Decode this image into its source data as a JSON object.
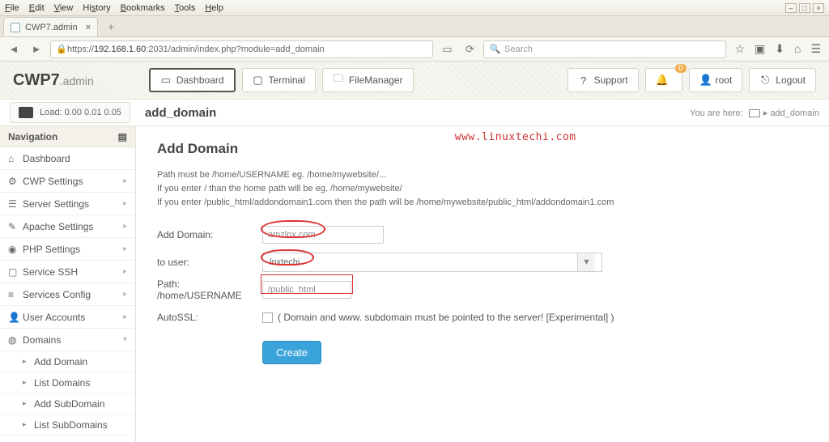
{
  "os_menubar": {
    "items": [
      "File",
      "Edit",
      "View",
      "History",
      "Bookmarks",
      "Tools",
      "Help"
    ]
  },
  "browser": {
    "tab_title": "CWP7.admin",
    "url_prefix": "https://",
    "url_host": "192.168.1.60",
    "url_rest": ":2031/admin/index.php?module=add_domain",
    "search_placeholder": "Search"
  },
  "brand": {
    "main": "CWP7",
    "suffix": ".admin"
  },
  "header_buttons": {
    "dashboard": "Dashboard",
    "terminal": "Terminal",
    "filemanager": "FileManager",
    "support": "Support",
    "user": "root",
    "logout": "Logout",
    "notif_count": "0"
  },
  "crumb": {
    "load_label": "Load: 0.00  0.01  0.05",
    "page_title": "add_domain",
    "here": "You are here:",
    "link": "add_domain"
  },
  "nav": {
    "header": "Navigation",
    "items": [
      "Dashboard",
      "CWP Settings",
      "Server Settings",
      "Apache Settings",
      "PHP Settings",
      "Service SSH",
      "Services Config",
      "User Accounts",
      "Domains"
    ],
    "sub": [
      "Add Domain",
      "List Domains",
      "Add SubDomain",
      "List SubDomains"
    ]
  },
  "content": {
    "title": "Add Domain",
    "help1": "Path must be /home/USERNAME eg. /home/mywebsite/...",
    "help2": "If you enter / than the home path will be eg. /home/mywebsite/",
    "help3": "If you enter /public_html/addondomain1.com then the path will be /home/mywebsite/public_html/addondomain1.com",
    "labels": {
      "add_domain": "Add Domain:",
      "to_user": "to user:",
      "path": "Path: /home/USERNAME",
      "autossl": "AutoSSL:"
    },
    "values": {
      "domain": "amzlnx.com",
      "user": "lnxtechi",
      "path": "/public_html"
    },
    "autossl_note": "( Domain and www. subdomain must be pointed to the server! [Experimental] )",
    "create": "Create",
    "watermark": "www.linuxtechi.com"
  }
}
